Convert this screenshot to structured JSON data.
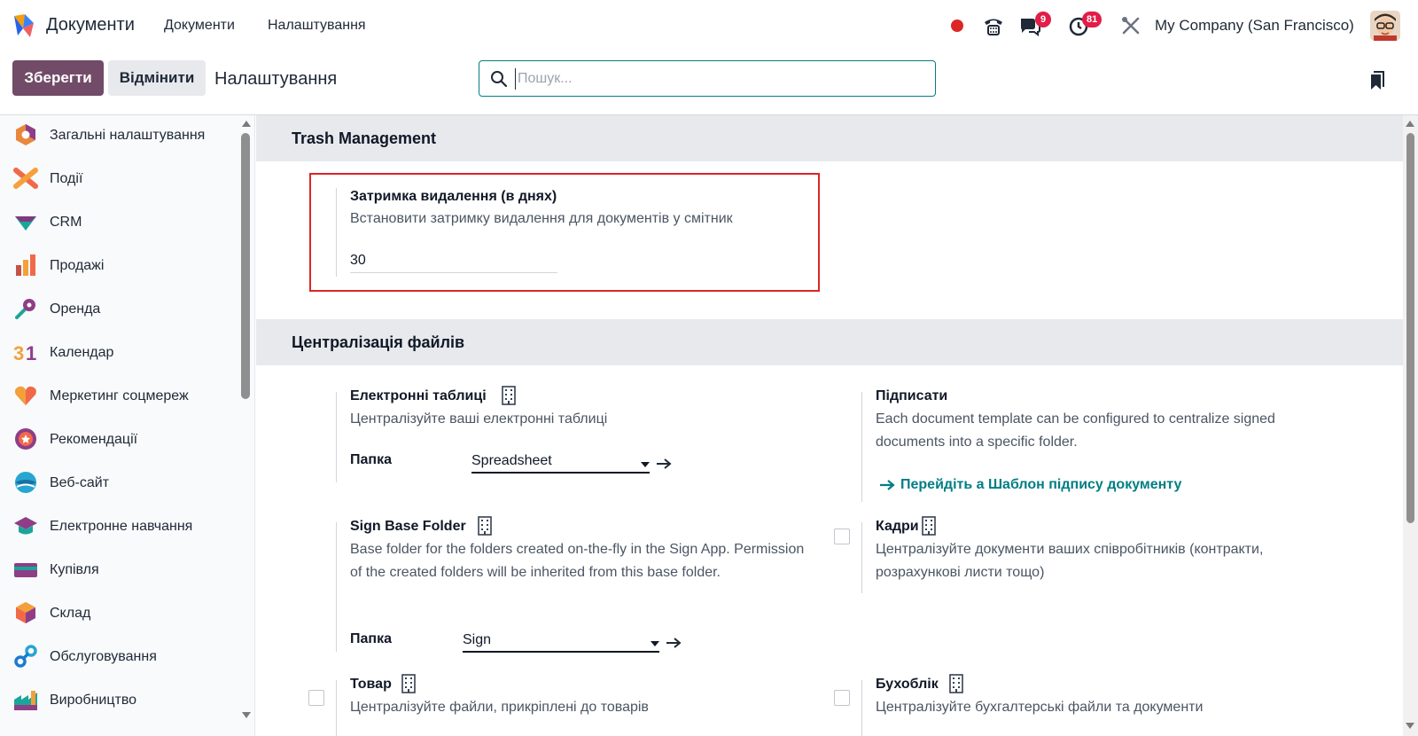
{
  "navbar": {
    "app_name": "Документи",
    "menu": [
      "Документи",
      "Налаштування"
    ],
    "chat_badge": "9",
    "activity_badge": "81",
    "company": "My Company (San Francisco)",
    "accent": "#714b67",
    "record_color": "#dc2626"
  },
  "control": {
    "save_label": "Зберегти",
    "cancel_label": "Відмінити",
    "title": "Налаштування",
    "search_placeholder": "Пошук..."
  },
  "sidebar": {
    "items": [
      {
        "label": "Загальні налаштування",
        "icon": "settings-hexagon-icon"
      },
      {
        "label": "Події",
        "icon": "events-icon"
      },
      {
        "label": "CRM",
        "icon": "crm-icon"
      },
      {
        "label": "Продажі",
        "icon": "sales-icon"
      },
      {
        "label": "Оренда",
        "icon": "rental-icon"
      },
      {
        "label": "Календар",
        "icon": "calendar-icon"
      },
      {
        "label": "Меркетинг соцмереж",
        "icon": "social-marketing-icon"
      },
      {
        "label": "Рекомендації",
        "icon": "referrals-icon"
      },
      {
        "label": "Веб-сайт",
        "icon": "website-icon"
      },
      {
        "label": "Електронне навчання",
        "icon": "elearning-icon"
      },
      {
        "label": "Купівля",
        "icon": "purchase-icon"
      },
      {
        "label": "Склад",
        "icon": "inventory-icon"
      },
      {
        "label": "Обслуговування",
        "icon": "maintenance-icon"
      },
      {
        "label": "Виробництво",
        "icon": "manufacturing-icon"
      }
    ]
  },
  "trash": {
    "section_title": "Trash Management",
    "setting_title": "Затримка видалення (в днях)",
    "setting_desc": "Встановити затримку видалення для документів у смітник",
    "value": "30"
  },
  "centralization": {
    "section_title": "Централізація файлів",
    "spreadsheets": {
      "title": "Електронні таблиці",
      "desc": "Централізуйте ваші електронні таблиці",
      "folder_label": "Папка",
      "folder_value": "Spreadsheet"
    },
    "sign": {
      "title": "Підписати",
      "desc": "Each document template can be configured to centralize signed documents into a specific folder.",
      "link": "Перейдіть а Шаблон підпису документу"
    },
    "sign_base": {
      "title": "Sign Base Folder",
      "desc": "Base folder for the folders created on-the-fly in the Sign App. Permission of the created folders will be inherited from this base folder.",
      "folder_label": "Папка",
      "folder_value": "Sign"
    },
    "hr": {
      "title": "Кадри",
      "desc": "Централізуйте документи ваших співробітників (контракти, розрахункові листи тощо)"
    },
    "product": {
      "title": "Товар",
      "desc": "Централізуйте файли, прикріплені до товарів"
    },
    "accounting": {
      "title": "Бухоблік",
      "desc": "Централізуйте бухгалтерські файли та документи"
    }
  }
}
